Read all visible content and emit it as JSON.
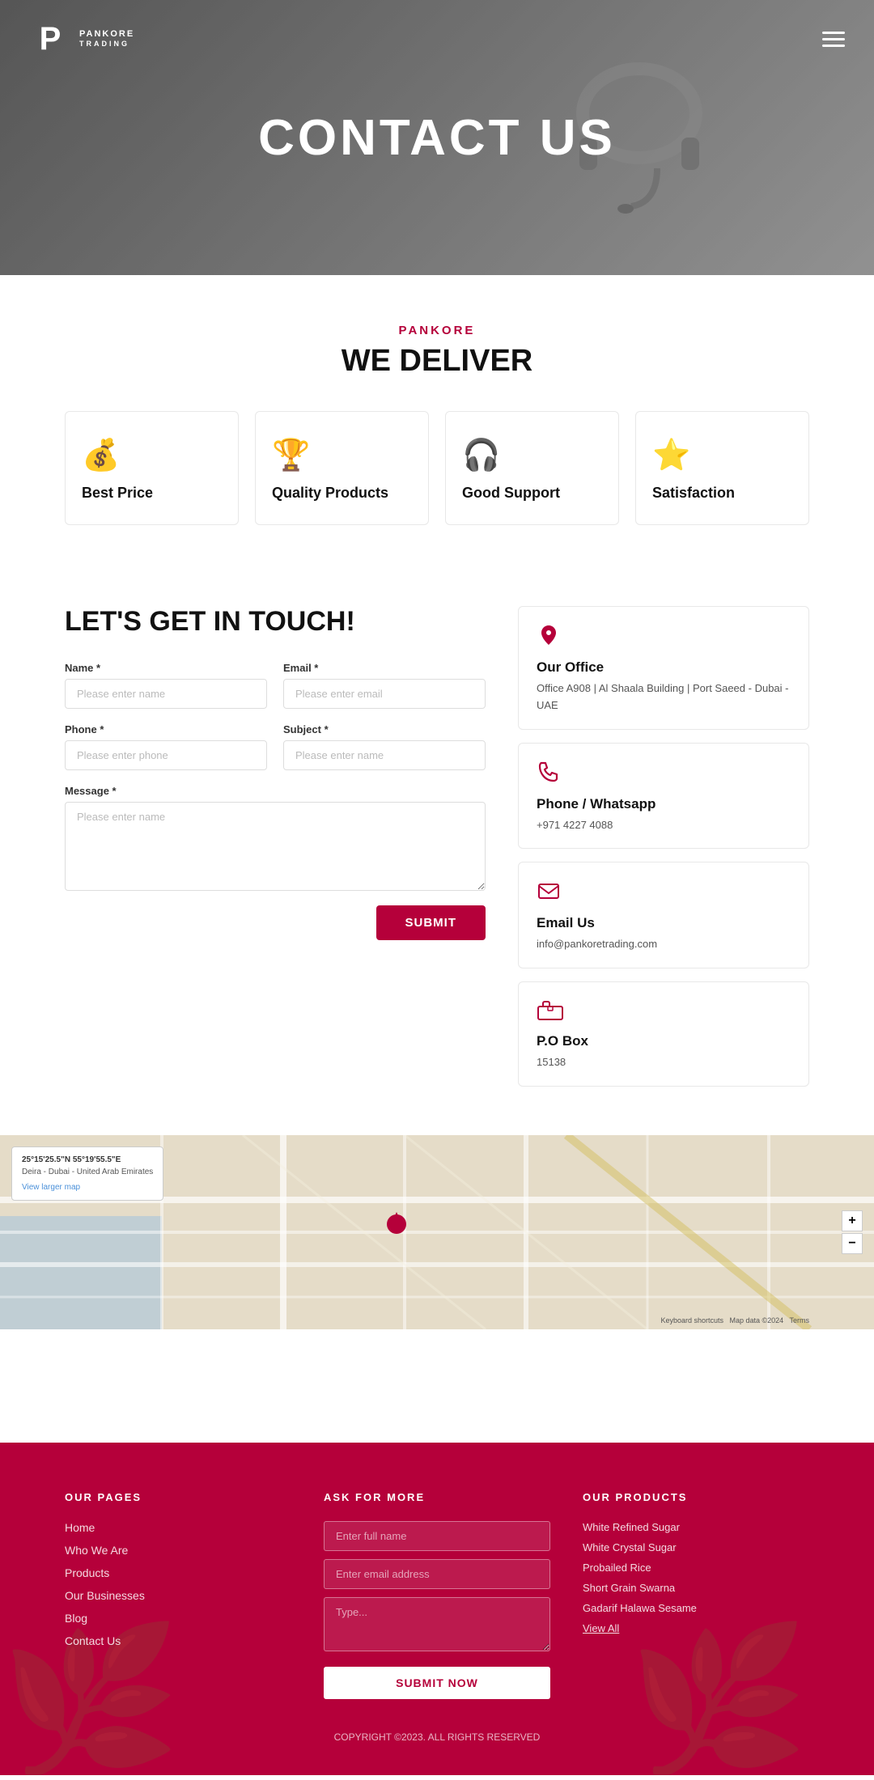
{
  "brand": "PANKORE",
  "nav": {
    "logo_line1": "PANKORE",
    "logo_p": "P",
    "logo_sub": "TRADING"
  },
  "hero": {
    "title": "CONTACT US"
  },
  "deliver": {
    "brand_label": "PANKORE",
    "title": "WE DELIVER",
    "cards": [
      {
        "icon": "💰",
        "label": "Best Price"
      },
      {
        "icon": "🏆",
        "label": "Quality Products"
      },
      {
        "icon": "🎧",
        "label": "Good Support"
      },
      {
        "icon": "⭐",
        "label": "Satisfaction"
      }
    ]
  },
  "contact": {
    "heading": "LET'S GET IN TOUCH!",
    "form": {
      "name_label": "Name *",
      "name_placeholder": "Please enter name",
      "email_label": "Email *",
      "email_placeholder": "Please enter email",
      "phone_label": "Phone *",
      "phone_placeholder": "Please enter phone",
      "subject_label": "Subject *",
      "subject_placeholder": "Please enter name",
      "message_label": "Message *",
      "message_placeholder": "Please enter name",
      "submit_label": "SUBMIT"
    },
    "info_cards": [
      {
        "icon": "🏢",
        "title": "Our Office",
        "text": "Office A908 | Al Shaala Building | Port Saeed - Dubai - UAE"
      },
      {
        "icon": "📞",
        "title": "Phone / Whatsapp",
        "text": "+971 4227 4088"
      },
      {
        "icon": "📧",
        "title": "Email Us",
        "text": "info@pankoretrading.com"
      },
      {
        "icon": "📫",
        "title": "P.O Box",
        "text": "15138"
      }
    ]
  },
  "map": {
    "coords": "25°15'25.5\"N 55°19'55.5\"E",
    "location": "Deira - Dubai - United Arab Emirates",
    "link": "View larger map"
  },
  "footer": {
    "pages_title": "OUR PAGES",
    "pages": [
      {
        "label": "Home"
      },
      {
        "label": "Who We Are"
      },
      {
        "label": "Products"
      },
      {
        "label": "Our Businesses"
      },
      {
        "label": "Blog"
      },
      {
        "label": "Contact Us"
      }
    ],
    "ask_title": "ASK FOR MORE",
    "ask_name_placeholder": "Enter full name",
    "ask_email_placeholder": "Enter email address",
    "ask_message_placeholder": "Type...",
    "ask_submit": "SUBMIT NOW",
    "products_title": "OUR PRODUCTS",
    "products": [
      {
        "label": "White Refined Sugar"
      },
      {
        "label": "White Crystal Sugar"
      },
      {
        "label": "Probailed Rice"
      },
      {
        "label": "Short Grain Swarna"
      },
      {
        "label": "Gadarif Halawa Sesame"
      }
    ],
    "view_all": "View All",
    "copyright": "COPYRIGHT  ©2023. ALL RIGHTS RESERVED"
  }
}
